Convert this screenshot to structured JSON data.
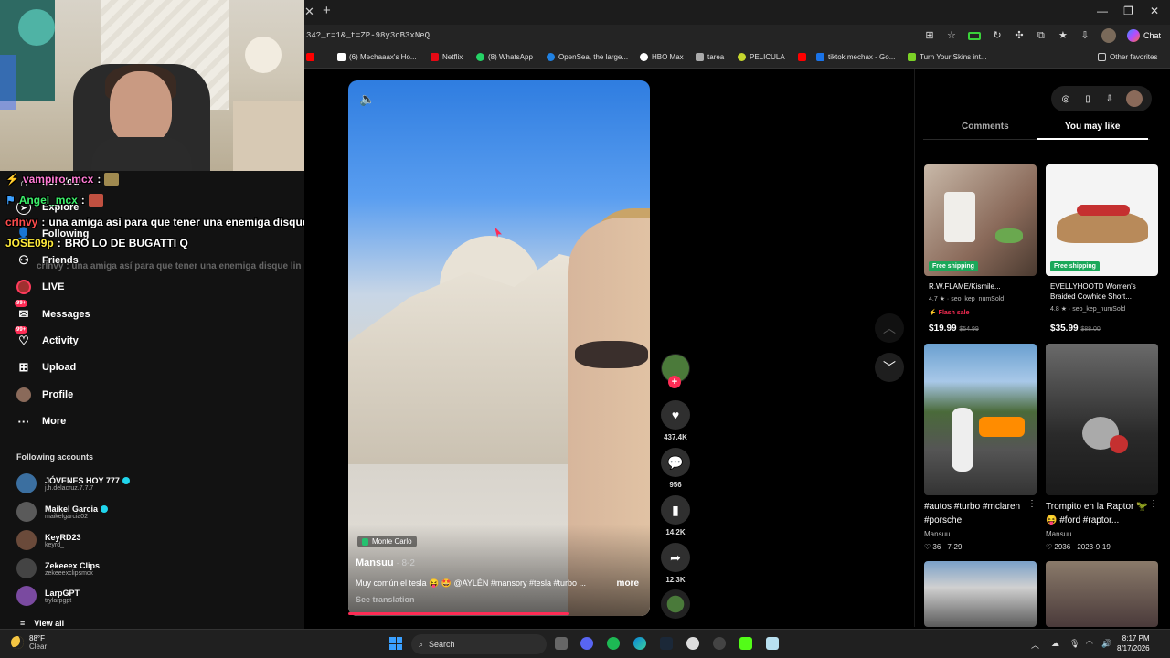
{
  "browser": {
    "url": "34?_r=1&_t=ZP-98y3oB3xNeQ",
    "chat_label": "Chat",
    "bookmarks": [
      {
        "label": "(6) Mechaaax's Ho...",
        "color": "#ffffff"
      },
      {
        "label": "Netflix",
        "color": "#e50914"
      },
      {
        "label": "(8) WhatsApp",
        "color": "#25d366"
      },
      {
        "label": "OpenSea, the large...",
        "color": "#2081e2"
      },
      {
        "label": "HBO Max",
        "color": "#ffffff"
      },
      {
        "label": "tarea",
        "color": "#aaaaaa"
      },
      {
        "label": "PELICULA",
        "color": "#c5d62e"
      },
      {
        "label": "tiktok mechax - Go...",
        "color": "#1a73e8"
      },
      {
        "label": "Turn Your Skins int...",
        "color": "#7bd126"
      }
    ],
    "other_favorites": "Other favorites"
  },
  "chat": [
    {
      "user": "vampiro_mcx",
      "text": "",
      "user_color": "#ff7bd5"
    },
    {
      "user": "Angel_mcx",
      "text": "",
      "user_color": "#3cf06a"
    },
    {
      "user": "crlnvy",
      "text": "una amiga así para que tener una enemiga disque",
      "user_color": "#ff4d4d"
    },
    {
      "user": "JOSE09p",
      "text": "BRO LO DE BUGATTI Q",
      "user_color": "#ffeb3b"
    }
  ],
  "chat_faded": "crlnvy : una amiga así para que tener una enemiga disque lin",
  "sidebar": {
    "items": [
      {
        "label": "For You",
        "icon": "home-icon"
      },
      {
        "label": "Explore",
        "icon": "compass-icon"
      },
      {
        "label": "Following",
        "icon": "following-icon"
      },
      {
        "label": "Friends",
        "icon": "friends-icon"
      },
      {
        "label": "LIVE",
        "icon": "live-icon"
      },
      {
        "label": "Messages",
        "icon": "messages-icon",
        "badge": "99+"
      },
      {
        "label": "Activity",
        "icon": "activity-icon",
        "badge": "99+"
      },
      {
        "label": "Upload",
        "icon": "upload-icon"
      },
      {
        "label": "Profile",
        "icon": "profile-icon"
      },
      {
        "label": "More",
        "icon": "more-icon"
      }
    ],
    "following_header": "Following accounts",
    "accounts": [
      {
        "name": "JÓVENES HOY 777",
        "handle": "j.h.delacruz.7.7.7",
        "verified": true,
        "color": "#3b6fa0"
      },
      {
        "name": "Maikel Garcia",
        "handle": "maikelgarcia02",
        "verified": true,
        "color": "#5a5a5a"
      },
      {
        "name": "KeyRD23",
        "handle": "keyrd_",
        "verified": false,
        "color": "#6a4a3a"
      },
      {
        "name": "Zekeeex Clips",
        "handle": "zekeeexclipsmcx",
        "verified": false,
        "color": "#444444"
      },
      {
        "name": "LarpGPT",
        "handle": "trylarpgpt",
        "verified": false,
        "color": "#7a4aa0"
      }
    ],
    "view_all": "View all"
  },
  "video": {
    "location": "Monte Carlo",
    "author": "Mansuu",
    "date": " · 8-2",
    "caption": "Muy común el tesla 😝 🤩 @AYLÉN #mansory #tesla #turbo ...",
    "more": "more",
    "see_translation": "See translation",
    "progress_fraction": 0.73
  },
  "actions": {
    "likes": "437.4K",
    "comments": "956",
    "saves": "14.2K",
    "shares": "12.3K"
  },
  "right_panel": {
    "tabs": [
      "Comments",
      "You may like"
    ],
    "active_tab": "You may like",
    "products": [
      {
        "title": "R.W.FLAME/Kismile...",
        "rating": "4.7",
        "sold": "seo_kep_numSold",
        "flash": "Flash sale",
        "price": "19.99",
        "old_price": "$54.99",
        "free_shipping": "Free shipping"
      },
      {
        "title": "EVELLYHOOTD Women's Braided Cowhide Short...",
        "rating": "4.8",
        "sold": "seo_kep_numSold",
        "price": "35.99",
        "old_price": "$88.00",
        "free_shipping": "Free shipping"
      }
    ],
    "videos": [
      {
        "title": "#autos #turbo #mclaren #porsche",
        "author": "Mansuu",
        "likes": "36",
        "date": "7-29"
      },
      {
        "title": "Trompito en la Raptor 🦖😝 #ford #raptor...",
        "author": "Mansuu",
        "likes": "2936",
        "date": "2023-9-19"
      }
    ]
  },
  "taskbar": {
    "temp": "88°F",
    "condition": "Clear",
    "search": "Search",
    "time": "8:17 PM",
    "date": "8/17/2026"
  }
}
